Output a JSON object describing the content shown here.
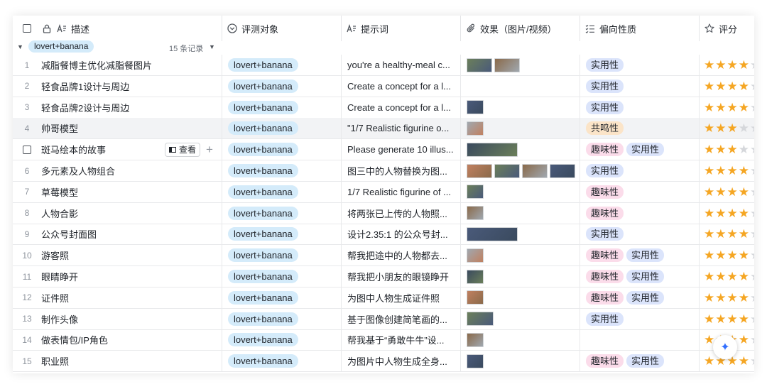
{
  "columns": {
    "description": "描述",
    "target": "评测对象",
    "prompt": "提示词",
    "effect": "效果（图片/视频）",
    "nature": "偏向性质",
    "score": "评分"
  },
  "group": {
    "label": "lovert+banana",
    "count": "15 条记录"
  },
  "view_button": "查看",
  "colors": {
    "pill": "#d4ebfa",
    "blue_tag": "#dbe4fb",
    "pink_tag": "#fbdcea",
    "orange_tag": "#fbe4c8",
    "star": "#f5a623"
  },
  "rows": [
    {
      "num": "1",
      "desc": "减脂餐博主优化减脂餐图片",
      "target": "lovert+banana",
      "prompt": "you're a healthy-meal c...",
      "thumbs": [
        2
      ],
      "tags": [
        {
          "text": "实用性",
          "color": "blue"
        }
      ],
      "stars": "4/5"
    },
    {
      "num": "2",
      "desc": "轻食品牌1设计与周边",
      "target": "lovert+banana",
      "prompt": "Create a concept for a l...",
      "thumbs": [],
      "tags": [
        {
          "text": "实用性",
          "color": "blue"
        }
      ],
      "stars": "4/5"
    },
    {
      "num": "3",
      "desc": "轻食品牌2设计与周边",
      "target": "lovert+banana",
      "prompt": "Create a concept for a l...",
      "thumbs": [
        1
      ],
      "tags": [
        {
          "text": "实用性",
          "color": "blue"
        }
      ],
      "stars": "4/5"
    },
    {
      "num": "4",
      "desc": "帅哥模型",
      "target": "lovert+banana",
      "prompt": "\"1/7 Realistic figurine o...",
      "thumbs": [
        1
      ],
      "tags": [
        {
          "text": "共鸣性",
          "color": "orange"
        }
      ],
      "stars": "3/5"
    },
    {
      "num": "",
      "desc": "斑马绘本的故事",
      "target": "lovert+banana",
      "prompt": "Please generate 10 illus...",
      "thumbs": [
        1
      ],
      "tags": [
        {
          "text": "趣味性",
          "color": "pink"
        },
        {
          "text": "实用性",
          "color": "blue"
        }
      ],
      "stars": "3/5"
    },
    {
      "num": "6",
      "desc": "多元素及人物组合",
      "target": "lovert+banana",
      "prompt": "图三中的人物替换为图...",
      "thumbs": [
        4
      ],
      "tags": [
        {
          "text": "实用性",
          "color": "blue"
        }
      ],
      "stars": "4/5"
    },
    {
      "num": "7",
      "desc": "草莓模型",
      "target": "lovert+banana",
      "prompt": "1/7 Realistic figurine of ...",
      "thumbs": [
        1
      ],
      "tags": [
        {
          "text": "趣味性",
          "color": "pink"
        }
      ],
      "stars": "4/5"
    },
    {
      "num": "8",
      "desc": "人物合影",
      "target": "lovert+banana",
      "prompt": "将两张已上传的人物照...",
      "thumbs": [
        1
      ],
      "tags": [
        {
          "text": "趣味性",
          "color": "pink"
        }
      ],
      "stars": "4/5"
    },
    {
      "num": "9",
      "desc": "公众号封面图",
      "target": "lovert+banana",
      "prompt": "设计2.35:1 的公众号封...",
      "thumbs": [
        1
      ],
      "tags": [
        {
          "text": "实用性",
          "color": "blue"
        }
      ],
      "stars": "4/5"
    },
    {
      "num": "10",
      "desc": "游客照",
      "target": "lovert+banana",
      "prompt": "帮我把途中的人物都去...",
      "thumbs": [
        1
      ],
      "tags": [
        {
          "text": "趣味性",
          "color": "pink"
        },
        {
          "text": "实用性",
          "color": "blue"
        }
      ],
      "stars": "4/5"
    },
    {
      "num": "11",
      "desc": "眼睛睁开",
      "target": "lovert+banana",
      "prompt": "帮我把小朋友的眼镜睁开",
      "thumbs": [
        1
      ],
      "tags": [
        {
          "text": "趣味性",
          "color": "pink"
        },
        {
          "text": "实用性",
          "color": "blue"
        }
      ],
      "stars": "4/5"
    },
    {
      "num": "12",
      "desc": "证件照",
      "target": "lovert+banana",
      "prompt": "为图中人物生成证件照",
      "thumbs": [
        1
      ],
      "tags": [
        {
          "text": "趣味性",
          "color": "pink"
        },
        {
          "text": "实用性",
          "color": "blue"
        }
      ],
      "stars": "4/5"
    },
    {
      "num": "13",
      "desc": "制作头像",
      "target": "lovert+banana",
      "prompt": "基于图像创建简笔画的...",
      "thumbs": [
        1
      ],
      "tags": [
        {
          "text": "实用性",
          "color": "blue"
        }
      ],
      "stars": "4/5"
    },
    {
      "num": "14",
      "desc": "做表情包/IP角色",
      "target": "lovert+banana",
      "prompt": "帮我基于“勇敢牛牛”设...",
      "thumbs": [
        1
      ],
      "tags": [],
      "stars": "4/5"
    },
    {
      "num": "15",
      "desc": "职业照",
      "target": "lovert+banana",
      "prompt": "为图片中人物生成全身...",
      "thumbs": [
        1
      ],
      "tags": [
        {
          "text": "趣味性",
          "color": "pink"
        },
        {
          "text": "实用性",
          "color": "blue"
        }
      ],
      "stars": "4/5"
    }
  ]
}
